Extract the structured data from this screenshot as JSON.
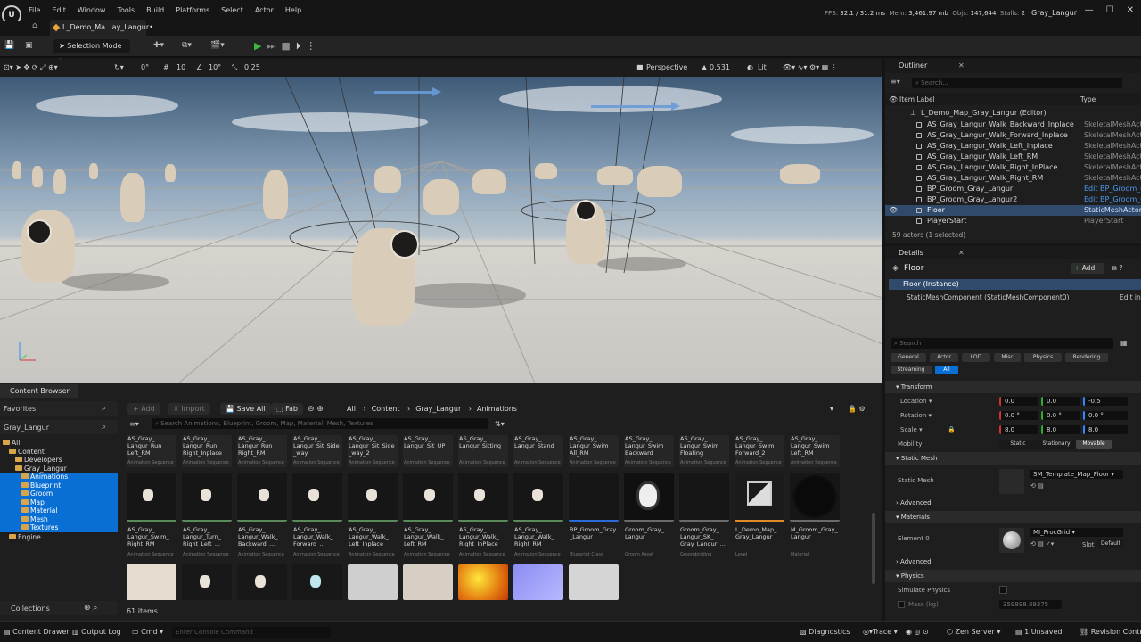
{
  "menu": [
    "File",
    "Edit",
    "Window",
    "Tools",
    "Build",
    "Platforms",
    "Select",
    "Actor",
    "Help"
  ],
  "stats": {
    "fps_label": "FPS:",
    "fps": "32.1",
    "ms": "/ 31.2 ms",
    "mem_label": "Mem:",
    "mem": "3,461.97 mb",
    "objs_label": "Objs:",
    "objs": "147,644",
    "stalls_label": "Stalls:",
    "stalls": "2"
  },
  "project_name": "Gray_Langur",
  "level_tab": "L_Demo_Ma...ay_Langur•",
  "toolbar": {
    "selection_mode": "Selection Mode"
  },
  "viewport_toolbar": {
    "rot_snap": "0°",
    "grid": "10",
    "angle": "10°",
    "scale": "0.25",
    "perspective": "Perspective",
    "fov": "0.531",
    "lit": "Lit"
  },
  "outliner": {
    "tab": "Outliner",
    "search_placeholder": "Search...",
    "col_label": "Item Label",
    "col_type": "Type",
    "level": "L_Demo_Map_Gray_Langur (Editor)",
    "rows": [
      {
        "label": "AS_Gray_Langur_Walk_Backward_Inplace",
        "type": "SkeletalMeshActo"
      },
      {
        "label": "AS_Gray_Langur_Walk_Forward_Inplace",
        "type": "SkeletalMeshActo"
      },
      {
        "label": "AS_Gray_Langur_Walk_Left_Inplace",
        "type": "SkeletalMeshActo"
      },
      {
        "label": "AS_Gray_Langur_Walk_Left_RM",
        "type": "SkeletalMeshActo"
      },
      {
        "label": "AS_Gray_Langur_Walk_Right_InPlace",
        "type": "SkeletalMeshActo"
      },
      {
        "label": "AS_Gray_Langur_Walk_Right_RM",
        "type": "SkeletalMeshActo"
      },
      {
        "label": "BP_Groom_Gray_Langur",
        "type": "Edit BP_Groom_G"
      },
      {
        "label": "BP_Groom_Gray_Langur2",
        "type": "Edit BP_Groom_G"
      },
      {
        "label": "Floor",
        "type": "StaticMeshActor"
      },
      {
        "label": "PlayerStart",
        "type": "PlayerStart"
      }
    ],
    "footer": "59 actors (1 selected)"
  },
  "details": {
    "tab": "Details",
    "object": "Floor",
    "add": "Add",
    "instance": "Floor (Instance)",
    "component": "StaticMeshComponent (StaticMeshComponent0)",
    "edit_in": "Edit in",
    "search_placeholder": "Search",
    "filters": [
      "General",
      "Actor",
      "LOD",
      "Misc",
      "Physics",
      "Rendering",
      "Streaming",
      "All"
    ],
    "transform": {
      "title": "Transform",
      "location": "Location",
      "rotation": "Rotation",
      "scale": "Scale",
      "loc": [
        "0.0",
        "0.0",
        "-0.5"
      ],
      "rot": [
        "0.0 °",
        "0.0 °",
        "0.0 °"
      ],
      "scl": [
        "8.0",
        "8.0",
        "8.0"
      ],
      "mobility": "Mobility",
      "mob_opts": [
        "Static",
        "Stationary",
        "Movable"
      ]
    },
    "static_mesh": {
      "title": "Static Mesh",
      "label": "Static Mesh",
      "value": "SM_Template_Map_Floor"
    },
    "advanced": "Advanced",
    "materials": {
      "title": "Materials",
      "label": "Element 0",
      "value": "MI_ProcGrid",
      "slot": "Slot",
      "default": "Default"
    },
    "physics": {
      "title": "Physics",
      "simulate": "Simulate Physics",
      "mass": "Mass (kg)",
      "mass_val": "359898.89375"
    }
  },
  "content_browser": {
    "tab": "Content Browser",
    "add": "Add",
    "import": "Import",
    "save_all": "Save All",
    "fab": "Fab",
    "breadcrumb": [
      "All",
      "Content",
      "Gray_Langur",
      "Animations"
    ],
    "search_placeholder": "Search Animations, Blueprint, Groom, Map, Material, Mesh, Textures",
    "favorites": "Favorites",
    "project": "Gray_Langur",
    "tree": [
      "All",
      "Content",
      "Developers",
      "Gray_Langur",
      "Animations",
      "Blueprint",
      "Groom",
      "Map",
      "Material",
      "Mesh",
      "Textures",
      "Engine"
    ],
    "collections": "Collections",
    "items_count": "61 items",
    "row1": [
      "AS_Gray_\nLangur_Run_\nLeft_RM",
      "AS_Gray_\nLangur_Run_\nRight_Inplace",
      "AS_Gray_\nLangur_Run_\nRight_RM",
      "AS_Gray_\nLangur_Sit_Side\n_way",
      "AS_Gray_\nLangur_Sit_Side\n_way_2",
      "AS_Gray_\nLangur_Sit_UP",
      "AS_Gray_\nLangur_Sitting",
      "AS_Gray_\nLangur_Stand",
      "AS_Gray_\nLangur_Swim_\nAll_RM",
      "AS_Gray_\nLangur_Swim_\nBackward",
      "AS_Gray_\nLangur_Swim_\nFloating",
      "AS_Gray_\nLangur_Swim_\nForward_2",
      "AS_Gray_\nLangur_Swim_\nLeft_RM"
    ],
    "row2": [
      {
        "name": "AS_Gray_\nLangur_Swim_\nRight_RM",
        "type": "Animation Sequence"
      },
      {
        "name": "AS_Gray_\nLangur_Turn_\nRight_Left_...",
        "type": "Animation Sequence"
      },
      {
        "name": "AS_Gray_\nLangur_Walk_\nBackward_...",
        "type": "Animation Sequence"
      },
      {
        "name": "AS_Gray_\nLangur_Walk_\nForward_...",
        "type": "Animation Sequence"
      },
      {
        "name": "AS_Gray_\nLangur_Walk_\nLeft_Inplace",
        "type": "Animation Sequence"
      },
      {
        "name": "AS_Gray_\nLangur_Walk_\nLeft_RM",
        "type": "Animation Sequence"
      },
      {
        "name": "AS_Gray_\nLangur_Walk_\nRight_InPlace",
        "type": "Animation Sequence"
      },
      {
        "name": "AS_Gray_\nLangur_Walk_\nRight_RM",
        "type": "Animation Sequence"
      },
      {
        "name": "BP_Groom_Gray\n_Langur",
        "type": "Blueprint Class"
      },
      {
        "name": "Groom_Gray_\nLangur",
        "type": "Groom Asset"
      },
      {
        "name": "Groom_Gray_\nLangur_SK_\nGray_Langur_...",
        "type": "Groombinding"
      },
      {
        "name": "L_Demo_Map_\nGray_Langur",
        "type": "Level"
      },
      {
        "name": "M_Groom_Gray_\nLangur",
        "type": "Material"
      }
    ],
    "row1_type": "Animation Sequence"
  },
  "statusbar": {
    "drawer": "Content Drawer",
    "output": "Output Log",
    "cmd": "Cmd",
    "console_placeholder": "Enter Console Command",
    "diagnostics": "Diagnostics",
    "trace": "Trace",
    "zen": "Zen Server",
    "unsaved": "1 Unsaved",
    "revision": "Revision Control"
  },
  "colors": {
    "accent": "#0a6fd4",
    "selection": "#0e7ae6",
    "anim_bar": "#5a8a5a"
  }
}
